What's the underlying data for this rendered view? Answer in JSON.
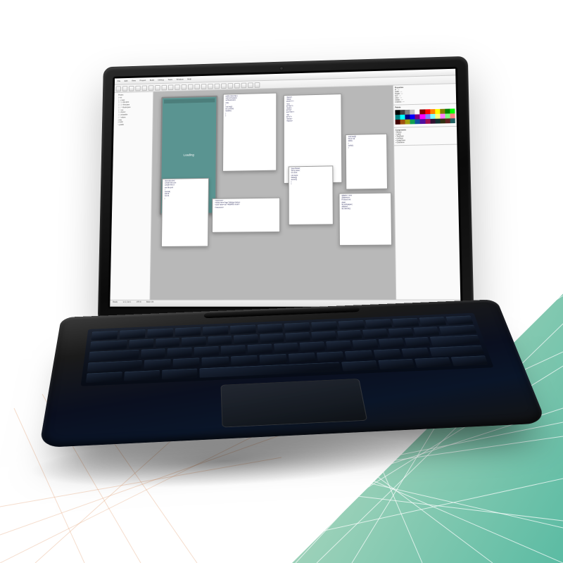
{
  "graphic": {
    "description": "Promotional product illustration of an open black laptop showing an IDE/design tool, placed over a geometric teal-and-peach line pattern",
    "colors": {
      "bg_white": "#ffffff",
      "gradient_left": "#f5c9a0",
      "gradient_right": "#5bbba3",
      "laptop_body": "#1a1a1a",
      "mobile_preview_bg": "#5a9491"
    }
  },
  "screen": {
    "menubar": [
      "File",
      "Edit",
      "View",
      "Project",
      "Build",
      "Debug",
      "Tools",
      "Window",
      "Help"
    ],
    "toolbar_button_count": 22,
    "left_tree": [
      "Project",
      " ├ src",
      " │  ├ main",
      " │  │  ├ App.java",
      " │  │  ├ View.java",
      " │  │  └ Model.java",
      " │  └ res",
      " │     ├ layout",
      " │     ├ drawable",
      " │     └ values",
      " ├ libs",
      " ├ build",
      " └ gradle"
    ],
    "mobile_label": "Loading",
    "right_panels": {
      "properties_title": "Properties",
      "properties_rows": [
        "id",
        "width",
        "height",
        "text",
        "color",
        "visible",
        "enabled"
      ],
      "palette_title": "Palette",
      "components_title": "Components",
      "components": [
        "Button",
        "Label",
        "TextField",
        "ListView",
        "ImageView",
        "Checkbox"
      ]
    },
    "palette_colors": [
      "#000000",
      "#404040",
      "#808080",
      "#c0c0c0",
      "#ffffff",
      "#800000",
      "#ff0000",
      "#ff8000",
      "#ffff00",
      "#808000",
      "#008000",
      "#00ff00",
      "#008080",
      "#00ffff",
      "#000080",
      "#0000ff",
      "#800080",
      "#ff00ff",
      "#8080ff",
      "#80ffff",
      "#ffff80",
      "#ff80ff",
      "#80ff80",
      "#ff8080",
      "#400000",
      "#a05010",
      "#a0a010",
      "#10a050",
      "#1050a0",
      "#5010a0",
      "#a01050",
      "#301030",
      "#103030",
      "#303010",
      "#602020",
      "#206060"
    ],
    "code_windows": [
      {
        "style": "top:6px; left:105px; width:80px; height:115px;",
        "lines": [
          "public class App {",
          "  void onCreate(){",
          "    setView(main);",
          "    init();",
          "  }",
          "  void init(){",
          "    btn.onClick(",
          "      handler);",
          "  }",
          "}"
        ]
      },
      {
        "style": "top:10px; left:195px; width:85px; height:130px;",
        "lines": [
          "<layout>",
          " <linear",
          " orient=\"v\">",
          " <text",
          " id=\"title\"/>",
          " <button",
          " id=\"btn\"",
          " text=\"OK\"/>",
          " <list",
          " id=\"lv\"/>",
          " </linear>",
          "</layout>"
        ]
      },
      {
        "style": "top:70px; left:285px; width:60px; height:80px;",
        "lines": [
          "void load(){",
          " for(i in a){",
          "  add(i);",
          " }",
          " notify();",
          "}"
        ]
      },
      {
        "style": "top:115px; left:202px; width:65px; height:85px;",
        "lines": [
          "class Model{",
          " String name;",
          " int count;",
          " List items;",
          " Model(){",
          "  items=[];",
          " }",
          "}"
        ]
      },
      {
        "style": "top:160px; left:90px; width:100px; height:50px;",
        "lines": [
          "<resources>",
          " <string name=\"app\">MyApp</string>",
          " <color name=\"pri\">#5a9491</color>",
          "</resources>"
        ]
      },
      {
        "style": "top:155px; left:275px; width:75px; height:75px;",
        "lines": [
          "adapter = new",
          " Adapter(ctx,",
          " R.layout.row,",
          " data);",
          "list.setAdapter(",
          " adapter);",
          "list.refresh();"
        ]
      },
      {
        "style": "top:130px; left:15px; width:70px; height:100px;",
        "lines": [
          "dependencies{",
          " compile libs.core",
          " compile libs.ui",
          " test libs.junit",
          "}",
          "android{",
          " sdk 33",
          " min 21",
          "}"
        ]
      }
    ],
    "statusbar": [
      "Ready",
      "Ln 1, Col 1",
      "UTF-8",
      "Build: OK"
    ]
  }
}
